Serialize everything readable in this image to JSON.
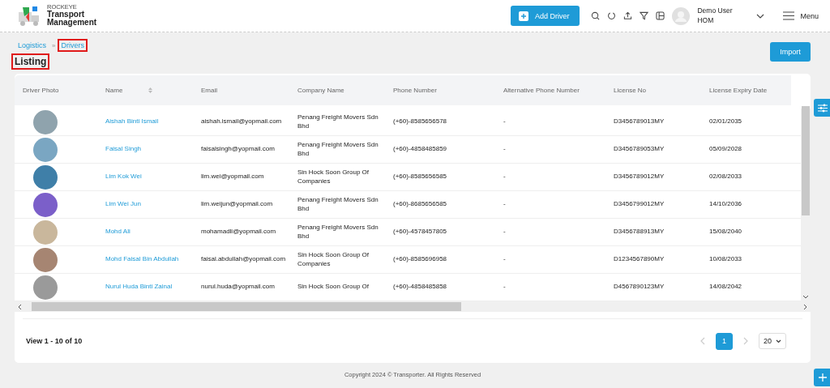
{
  "header": {
    "brand_small": "ROCKEYE",
    "brand_line1": "Transport",
    "brand_line2": "Management",
    "add_button": "Add Driver",
    "user_name": "Demo User",
    "user_role": "HOM",
    "menu_label": "Menu"
  },
  "breadcrumb_separator": "»",
  "breadcrumb": [
    {
      "label": "Logistics",
      "highlighted": false
    },
    {
      "label": "Drivers",
      "highlighted": true
    }
  ],
  "page_title": {
    "label": "Listing",
    "highlighted": true
  },
  "import_button": "Import",
  "table": {
    "columns": [
      {
        "label": "Driver Photo",
        "sortable": false
      },
      {
        "label": "Name",
        "sortable": true
      },
      {
        "label": "Email",
        "sortable": false
      },
      {
        "label": "Company Name",
        "sortable": false
      },
      {
        "label": "Phone Number",
        "sortable": false
      },
      {
        "label": "Alternative Phone Number",
        "sortable": false
      },
      {
        "label": "License No",
        "sortable": false
      },
      {
        "label": "License Expiry Date",
        "sortable": false
      }
    ],
    "rows": [
      {
        "name": "Aishah Binti Ismail",
        "email": "aishah.ismail@yopmail.com",
        "company": "Penang Freight Movers Sdn Bhd",
        "phone": "(+60)-8585656578",
        "alt_phone": "-",
        "license_no": "D3456789013MY",
        "license_expiry": "02/01/2035"
      },
      {
        "name": "Faisal Singh",
        "email": "faisalsingh@yopmail.com",
        "company": "Penang Freight Movers Sdn Bhd",
        "phone": "(+60)-4858485859",
        "alt_phone": "-",
        "license_no": "D3456789053MY",
        "license_expiry": "05/09/2028"
      },
      {
        "name": "Lim Kok Wei",
        "email": "lim.wei@yopmail.com",
        "company": "Sin Hock Soon Group Of Companies",
        "phone": "(+60)-8585656585",
        "alt_phone": "-",
        "license_no": "D3456789012MY",
        "license_expiry": "02/08/2033"
      },
      {
        "name": "Lim Wei Jun",
        "email": "lim.weijun@yopmail.com",
        "company": "Penang Freight Movers Sdn Bhd",
        "phone": "(+60)-8685656585",
        "alt_phone": "-",
        "license_no": "D3456799012MY",
        "license_expiry": "14/10/2036"
      },
      {
        "name": "Mohd Ali",
        "email": "mohamadli@yopmail.com",
        "company": "Penang Freight Movers Sdn Bhd",
        "phone": "(+60)-4578457805",
        "alt_phone": "-",
        "license_no": "D3456788913MY",
        "license_expiry": "15/08/2040"
      },
      {
        "name": "Mohd Faisal Bin Abdullah",
        "email": "faisal.abdullah@yopmail.com",
        "company": "Sin Hock Soon Group Of Companies",
        "phone": "(+60)-8585696958",
        "alt_phone": "-",
        "license_no": "D1234567890MY",
        "license_expiry": "10/08/2033"
      },
      {
        "name": "Nurul Huda Binti Zainal",
        "email": "nurul.huda@yopmail.com",
        "company": "Sin Hock Soon Group Of",
        "phone": "(+60)-4858485858",
        "alt_phone": "-",
        "license_no": "D4567890123MY",
        "license_expiry": "14/08/2042"
      }
    ]
  },
  "pagination": {
    "summary": "View 1 - 10 of 10",
    "prev_disabled": true,
    "next_disabled": true,
    "pages": [
      {
        "label": "1",
        "selected": true
      }
    ],
    "page_size": "20"
  },
  "footer": "Copyright 2024 © Transporter. All Rights Reserved"
}
